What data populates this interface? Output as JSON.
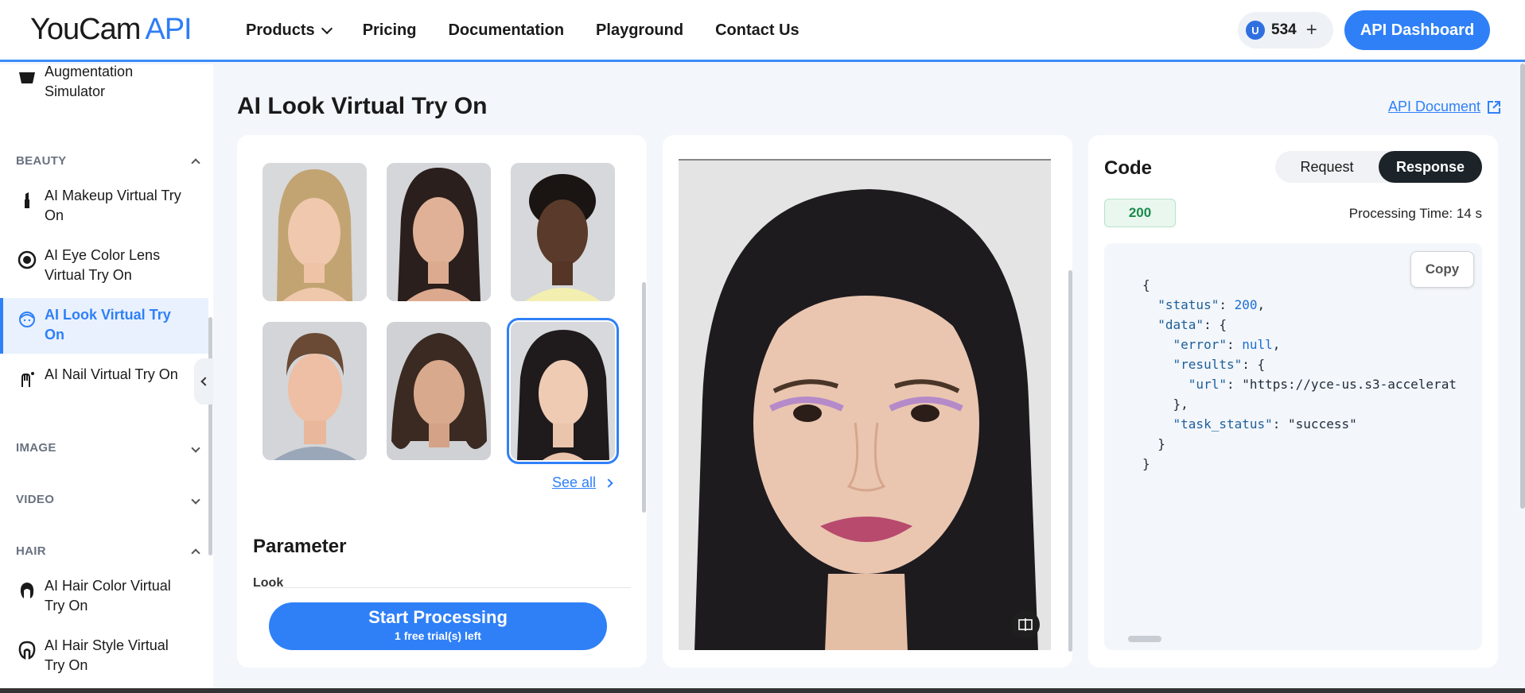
{
  "header": {
    "logo_text": "YouCam",
    "logo_accent": "API",
    "nav": [
      {
        "label": "Products",
        "has_dropdown": true
      },
      {
        "label": "Pricing"
      },
      {
        "label": "Documentation"
      },
      {
        "label": "Playground"
      },
      {
        "label": "Contact Us"
      }
    ],
    "credits": "534",
    "credits_coin": "U",
    "credits_add": "+",
    "dashboard_button": "API Dashboard"
  },
  "sidebar": {
    "top_item": "Augmentation Simulator",
    "sections": [
      {
        "label": "BEAUTY",
        "expanded": true
      },
      {
        "label": "IMAGE",
        "expanded": false
      },
      {
        "label": "VIDEO",
        "expanded": false
      },
      {
        "label": "HAIR",
        "expanded": true
      }
    ],
    "beauty_items": [
      {
        "label": "AI Makeup Virtual Try On",
        "icon": "lipstick-icon"
      },
      {
        "label": "AI Eye Color Lens Virtual Try On",
        "icon": "eye-lens-icon"
      },
      {
        "label": "AI Look Virtual Try On",
        "icon": "face-look-icon",
        "active": true
      },
      {
        "label": "AI Nail Virtual Try On",
        "icon": "nail-icon"
      }
    ],
    "hair_items": [
      {
        "label": "AI Hair Color Virtual Try On",
        "icon": "hair-color-icon"
      },
      {
        "label": "AI Hair Style Virtual Try On",
        "icon": "hair-style-icon"
      }
    ]
  },
  "main": {
    "title": "AI Look Virtual Try On",
    "api_document": "API Document",
    "see_all": "See all",
    "parameter_title": "Parameter",
    "parameter_look_label": "Look",
    "start_button": "Start Processing",
    "start_sub": "1 free trial(s) left",
    "selected_thumbnail_index": 5
  },
  "code_panel": {
    "title": "Code",
    "tabs": [
      {
        "label": "Request",
        "active": false
      },
      {
        "label": "Response",
        "active": true
      }
    ],
    "status_code": "200",
    "processing_time": "Processing Time: 14 s",
    "copy_label": "Copy",
    "response": {
      "status": "200",
      "error": "null",
      "url": "\"https://yce-us.s3-accelerat",
      "task_status": "\"success\""
    }
  },
  "colors": {
    "accent": "#2f80f7",
    "active_bg": "#e9f1fe",
    "status_green": "#1a8a4c"
  }
}
